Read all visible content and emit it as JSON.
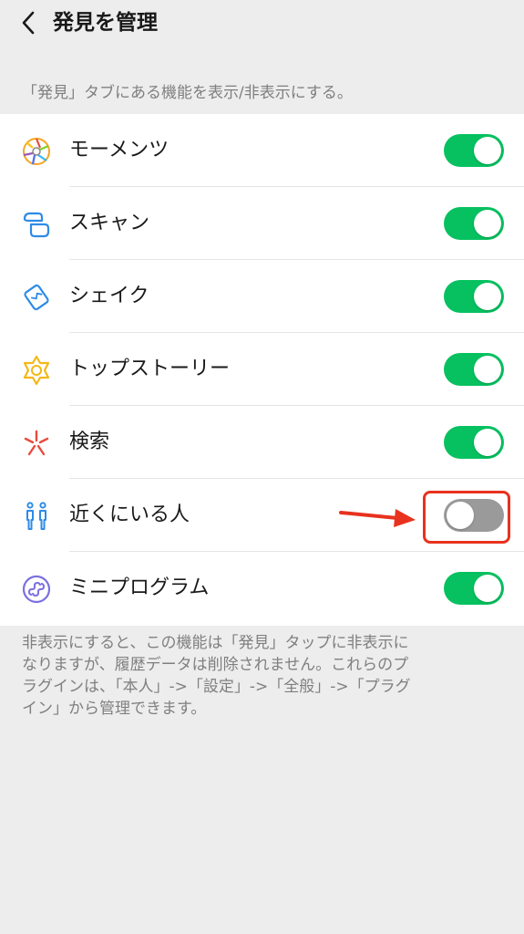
{
  "header": {
    "title": "発見を管理",
    "back_icon": "chevron-left-icon"
  },
  "description": "「発見」タブにある機能を表示/非表示にする。",
  "items": [
    {
      "label": "モーメンツ",
      "icon": "moments-icon",
      "enabled": true
    },
    {
      "label": "スキャン",
      "icon": "scan-icon",
      "enabled": true
    },
    {
      "label": "シェイク",
      "icon": "shake-icon",
      "enabled": true
    },
    {
      "label": "トップストーリー",
      "icon": "top-stories-icon",
      "enabled": true
    },
    {
      "label": "検索",
      "icon": "search-icon",
      "enabled": true
    },
    {
      "label": "近くにいる人",
      "icon": "people-nearby-icon",
      "enabled": false
    },
    {
      "label": "ミニプログラム",
      "icon": "mini-program-icon",
      "enabled": true
    }
  ],
  "footer": {
    "lines": [
      "非表示にすると、この機能は「発見」タップに非表示に",
      "なりますが、履歴データは削除されません。これらのプ",
      "ラグインは、「本人」->「設定」->「全般」->「プラグ",
      "イン」から管理できます。"
    ]
  },
  "colors": {
    "toggle_on": "#07c160",
    "toggle_off": "#9a9a9a",
    "annotation": "#e8321f",
    "background": "#ededed"
  }
}
